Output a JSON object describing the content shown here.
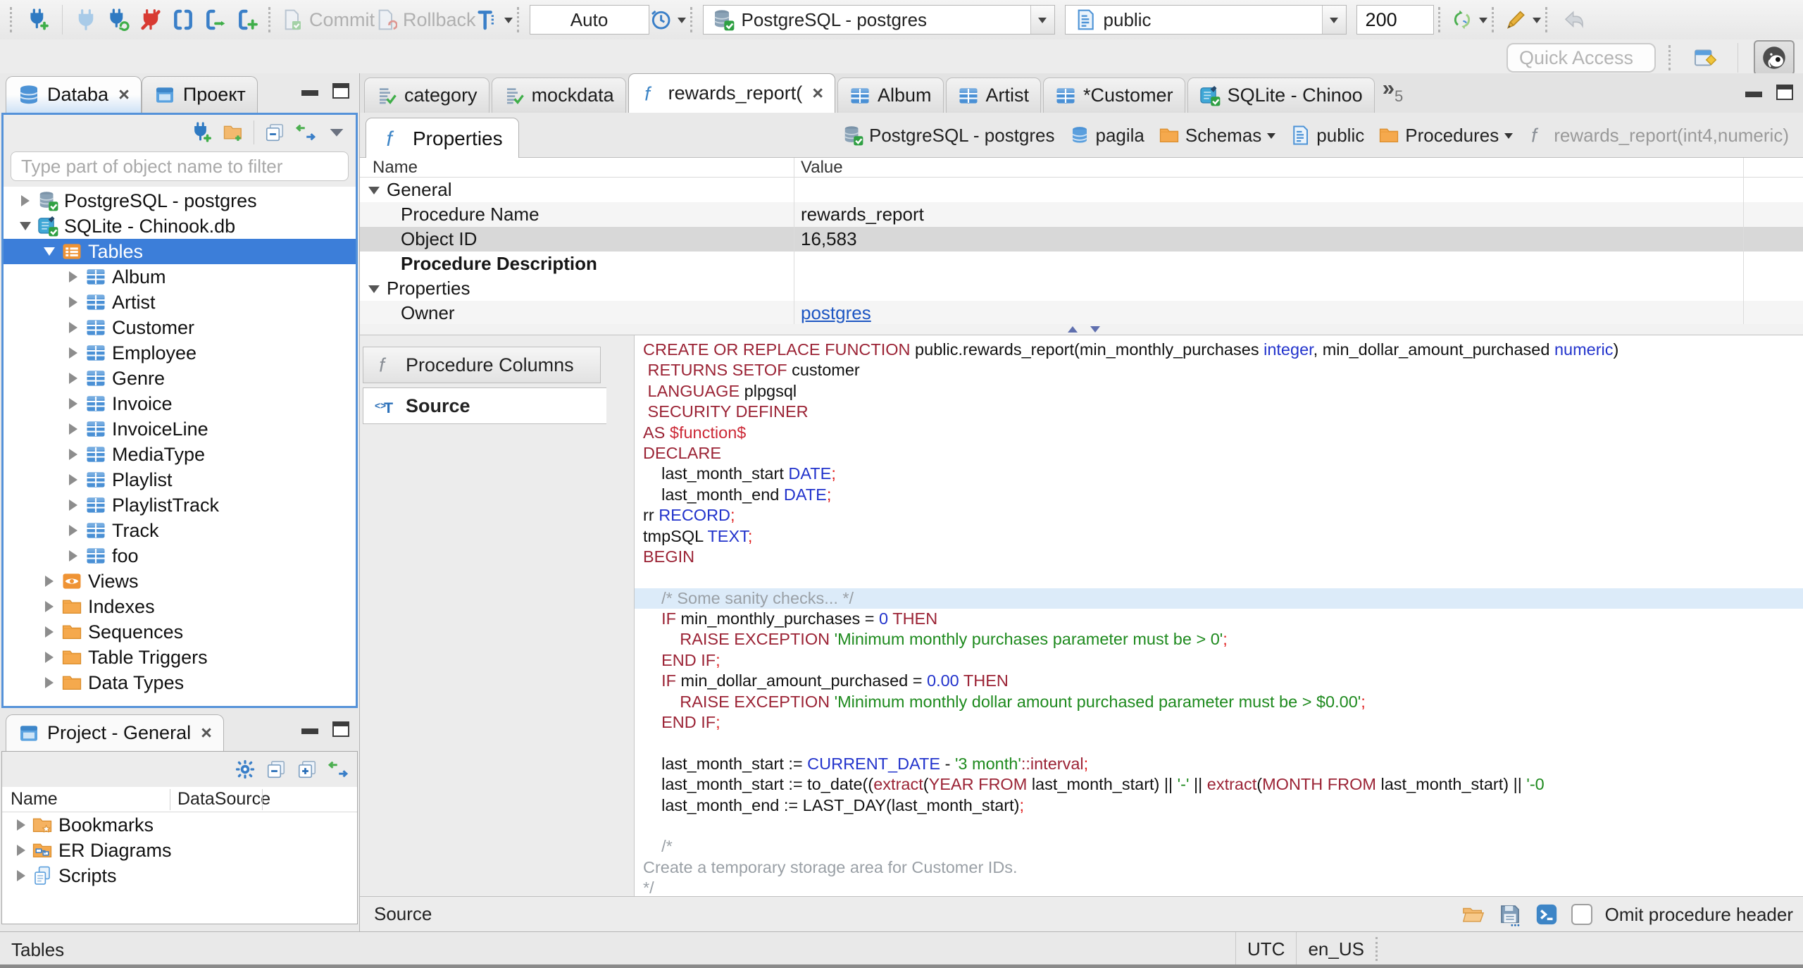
{
  "toolbar": {
    "commit_label": "Commit",
    "rollback_label": "Rollback",
    "auto_value": "Auto",
    "connection_value": "PostgreSQL - postgres",
    "schema_value": "public",
    "fetch_size_value": "200"
  },
  "quick_access": {
    "placeholder": "Quick Access"
  },
  "left": {
    "tabs": [
      {
        "label": "Databa"
      },
      {
        "label": "Проект"
      }
    ],
    "filter_placeholder": "Type part of object name to filter",
    "tree": [
      {
        "label": "PostgreSQL - postgres",
        "icon": "conn-pg",
        "level": 0,
        "arrow": "r"
      },
      {
        "label": "SQLite - Chinook.db",
        "icon": "conn-sqlite",
        "level": 0,
        "arrow": "d"
      },
      {
        "label": "Tables",
        "icon": "folder-tables",
        "level": 1,
        "arrow": "d",
        "selected": true
      },
      {
        "label": "Album",
        "icon": "table-grid",
        "level": 2,
        "arrow": "r"
      },
      {
        "label": "Artist",
        "icon": "table-grid",
        "level": 2,
        "arrow": "r"
      },
      {
        "label": "Customer",
        "icon": "table-grid",
        "level": 2,
        "arrow": "r"
      },
      {
        "label": "Employee",
        "icon": "table-grid",
        "level": 2,
        "arrow": "r"
      },
      {
        "label": "Genre",
        "icon": "table-grid",
        "level": 2,
        "arrow": "r"
      },
      {
        "label": "Invoice",
        "icon": "table-grid",
        "level": 2,
        "arrow": "r"
      },
      {
        "label": "InvoiceLine",
        "icon": "table-grid",
        "level": 2,
        "arrow": "r"
      },
      {
        "label": "MediaType",
        "icon": "table-grid",
        "level": 2,
        "arrow": "r"
      },
      {
        "label": "Playlist",
        "icon": "table-grid",
        "level": 2,
        "arrow": "r"
      },
      {
        "label": "PlaylistTrack",
        "icon": "table-grid",
        "level": 2,
        "arrow": "r"
      },
      {
        "label": "Track",
        "icon": "table-grid",
        "level": 2,
        "arrow": "r"
      },
      {
        "label": "foo",
        "icon": "table-grid",
        "level": 2,
        "arrow": "r"
      },
      {
        "label": "Views",
        "icon": "views-eye",
        "level": 1,
        "arrow": "r"
      },
      {
        "label": "Indexes",
        "icon": "folder",
        "level": 1,
        "arrow": "r"
      },
      {
        "label": "Sequences",
        "icon": "folder",
        "level": 1,
        "arrow": "r"
      },
      {
        "label": "Table Triggers",
        "icon": "folder",
        "level": 1,
        "arrow": "r"
      },
      {
        "label": "Data Types",
        "icon": "folder",
        "level": 1,
        "arrow": "r"
      }
    ]
  },
  "project": {
    "tab_label": "Project - General",
    "columns": [
      "Name",
      "DataSource"
    ],
    "rows": [
      {
        "label": "Bookmarks",
        "icon": "folder-star"
      },
      {
        "label": "ER Diagrams",
        "icon": "folder-er"
      },
      {
        "label": "Scripts",
        "icon": "scripts"
      }
    ]
  },
  "editor": {
    "tabs": [
      {
        "label": "category",
        "icon": "script-check"
      },
      {
        "label": "mockdata",
        "icon": "script-check"
      },
      {
        "label": "rewards_report(",
        "icon": "func-f",
        "active": true,
        "closable": true
      },
      {
        "label": "Album",
        "icon": "table-grid"
      },
      {
        "label": "Artist",
        "icon": "table-grid"
      },
      {
        "label": "*Customer",
        "icon": "table-grid"
      },
      {
        "label": "SQLite - Chinoo",
        "icon": "conn-sqlite"
      }
    ],
    "overflow_count": "5",
    "properties_tab_label": "Properties",
    "breadcrumb": [
      {
        "label": "PostgreSQL - postgres",
        "icon": "conn-pg"
      },
      {
        "label": "pagila",
        "icon": "db-blue"
      },
      {
        "label": "Schemas",
        "icon": "folder",
        "caret": true
      },
      {
        "label": "public",
        "icon": "schema-doc"
      },
      {
        "label": "Procedures",
        "icon": "folder",
        "caret": true
      },
      {
        "label": "rewards_report(int4,numeric)",
        "icon": "func-gray",
        "muted": true
      }
    ],
    "grid": {
      "columns": [
        "Name",
        "Value"
      ],
      "rows": [
        {
          "name": "General",
          "group": true
        },
        {
          "name": "Procedure Name",
          "value": "rewards_report",
          "shade": true
        },
        {
          "name": "Object ID",
          "value": "16,583",
          "selected": true
        },
        {
          "name": "Procedure Description",
          "bold": true
        },
        {
          "name": "Properties",
          "group": true
        },
        {
          "name": "Owner",
          "value": "postgres",
          "link": true,
          "shade": true
        }
      ]
    },
    "subtabs": [
      {
        "label": "Procedure Columns",
        "icon": "func-gray"
      },
      {
        "label": "Source",
        "icon": "source-tag",
        "active": true
      }
    ],
    "footer": {
      "label": "Source",
      "checkbox_label": "Omit procedure header"
    }
  },
  "code": {
    "lines": [
      {
        "seg": [
          [
            "kw",
            "CREATE OR REPLACE FUNCTION"
          ],
          [
            "pl",
            " public.rewards_report(min_monthly_purchases "
          ],
          [
            "ty",
            "integer"
          ],
          [
            "pl",
            ", min_dollar_amount_purchased "
          ],
          [
            "ty",
            "numeric"
          ],
          [
            "pl",
            ")"
          ]
        ]
      },
      {
        "seg": [
          [
            "pl",
            " "
          ],
          [
            "kw",
            "RETURNS SETOF"
          ],
          [
            "pl",
            " customer"
          ]
        ]
      },
      {
        "seg": [
          [
            "pl",
            " "
          ],
          [
            "kw",
            "LANGUAGE"
          ],
          [
            "pl",
            " plpgsql"
          ]
        ]
      },
      {
        "seg": [
          [
            "pl",
            " "
          ],
          [
            "kw",
            "SECURITY DEFINER"
          ]
        ]
      },
      {
        "seg": [
          [
            "kw",
            "AS"
          ],
          [
            "pl",
            " "
          ],
          [
            "dl",
            "$function$"
          ]
        ]
      },
      {
        "seg": [
          [
            "kw",
            "DECLARE"
          ]
        ]
      },
      {
        "seg": [
          [
            "pl",
            "    last_month_start "
          ],
          [
            "ty",
            "DATE"
          ],
          [
            "se",
            ";"
          ]
        ]
      },
      {
        "seg": [
          [
            "pl",
            "    last_month_end "
          ],
          [
            "ty",
            "DATE"
          ],
          [
            "se",
            ";"
          ]
        ]
      },
      {
        "seg": [
          [
            "pl",
            "rr "
          ],
          [
            "ty",
            "RECORD"
          ],
          [
            "se",
            ";"
          ]
        ]
      },
      {
        "seg": [
          [
            "pl",
            "tmpSQL "
          ],
          [
            "ty",
            "TEXT"
          ],
          [
            "se",
            ";"
          ]
        ]
      },
      {
        "seg": [
          [
            "kw",
            "BEGIN"
          ]
        ]
      },
      {
        "seg": []
      },
      {
        "hl": true,
        "seg": [
          [
            "co",
            "    /* Some sanity checks... */"
          ]
        ]
      },
      {
        "seg": [
          [
            "pl",
            "    "
          ],
          [
            "kw",
            "IF"
          ],
          [
            "pl",
            " min_monthly_purchases = "
          ],
          [
            "nu",
            "0"
          ],
          [
            "pl",
            " "
          ],
          [
            "kw",
            "THEN"
          ]
        ]
      },
      {
        "seg": [
          [
            "pl",
            "        "
          ],
          [
            "kw",
            "RAISE EXCEPTION"
          ],
          [
            "pl",
            " "
          ],
          [
            "st",
            "'Minimum monthly purchases parameter must be > 0'"
          ],
          [
            "se",
            ";"
          ]
        ]
      },
      {
        "seg": [
          [
            "pl",
            "    "
          ],
          [
            "kw",
            "END IF"
          ],
          [
            "se",
            ";"
          ]
        ]
      },
      {
        "seg": [
          [
            "pl",
            "    "
          ],
          [
            "kw",
            "IF"
          ],
          [
            "pl",
            " min_dollar_amount_purchased = "
          ],
          [
            "nu",
            "0.00"
          ],
          [
            "pl",
            " "
          ],
          [
            "kw",
            "THEN"
          ]
        ]
      },
      {
        "seg": [
          [
            "pl",
            "        "
          ],
          [
            "kw",
            "RAISE EXCEPTION"
          ],
          [
            "pl",
            " "
          ],
          [
            "st",
            "'Minimum monthly dollar amount purchased parameter must be > $0.00'"
          ],
          [
            "se",
            ";"
          ]
        ]
      },
      {
        "seg": [
          [
            "pl",
            "    "
          ],
          [
            "kw",
            "END IF"
          ],
          [
            "se",
            ";"
          ]
        ]
      },
      {
        "seg": []
      },
      {
        "seg": [
          [
            "pl",
            "    last_month_start := "
          ],
          [
            "ty",
            "CURRENT_DATE"
          ],
          [
            "pl",
            " - "
          ],
          [
            "st",
            "'3 month'"
          ],
          [
            "kw",
            "::interval"
          ],
          [
            "se",
            ";"
          ]
        ]
      },
      {
        "seg": [
          [
            "pl",
            "    last_month_start := to_date(("
          ],
          [
            "kw",
            "extract"
          ],
          [
            "pl",
            "("
          ],
          [
            "kw",
            "YEAR FROM"
          ],
          [
            "pl",
            " last_month_start) || "
          ],
          [
            "st",
            "'-'"
          ],
          [
            "pl",
            " || "
          ],
          [
            "kw",
            "extract"
          ],
          [
            "pl",
            "("
          ],
          [
            "kw",
            "MONTH FROM"
          ],
          [
            "pl",
            " last_month_start) || "
          ],
          [
            "st",
            "'-0"
          ]
        ]
      },
      {
        "seg": [
          [
            "pl",
            "    last_month_end := LAST_DAY(last_month_start)"
          ],
          [
            "se",
            ";"
          ]
        ]
      },
      {
        "seg": []
      },
      {
        "seg": [
          [
            "co",
            "    /*"
          ]
        ]
      },
      {
        "seg": [
          [
            "co",
            "Create a temporary storage area for Customer IDs."
          ]
        ]
      },
      {
        "seg": [
          [
            "co",
            "*/"
          ]
        ]
      }
    ]
  },
  "statusbar": {
    "left": "Tables",
    "timezone": "UTC",
    "locale": "en_US"
  },
  "colors": {
    "selection": "#3c7ed9",
    "focus_border": "#5592d9",
    "keyword": "#9b2335",
    "string": "#1e8a1e"
  }
}
